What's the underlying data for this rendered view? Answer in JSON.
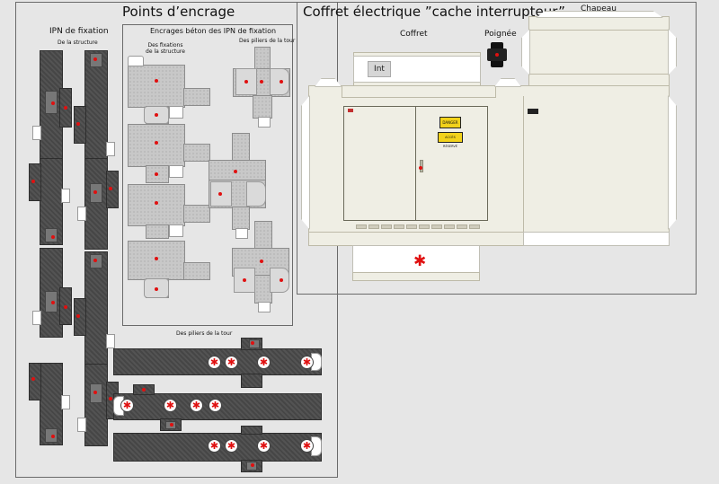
{
  "anchoring": {
    "title": "Points d’encrage",
    "ipn_label": "IPN de fixation",
    "ipn_sub_label": "De la structure",
    "beton_label": "Encrages béton des IPN de fixation",
    "beton_sub_structure": "Des fixations de la structure",
    "beton_sub_tower": "Des piliers de la tour",
    "pillars_label": "Des piliers de la tour"
  },
  "cabinet": {
    "title": "Coffret électrique ”cache interrupteur”",
    "coffret_label": "Coffret",
    "poignee_label": "Poignée",
    "chapeau_label": "Chapeau",
    "int_label": "Int",
    "warning_sign_1": "DANGER",
    "warning_sign_2": "ACCÈS RÉSERVÉ",
    "colors": {
      "panel_beige": "#efeee4",
      "red_marker": "#e01010",
      "steel_dark": "#4a4a4a",
      "concrete": "#c8c8c8"
    }
  }
}
